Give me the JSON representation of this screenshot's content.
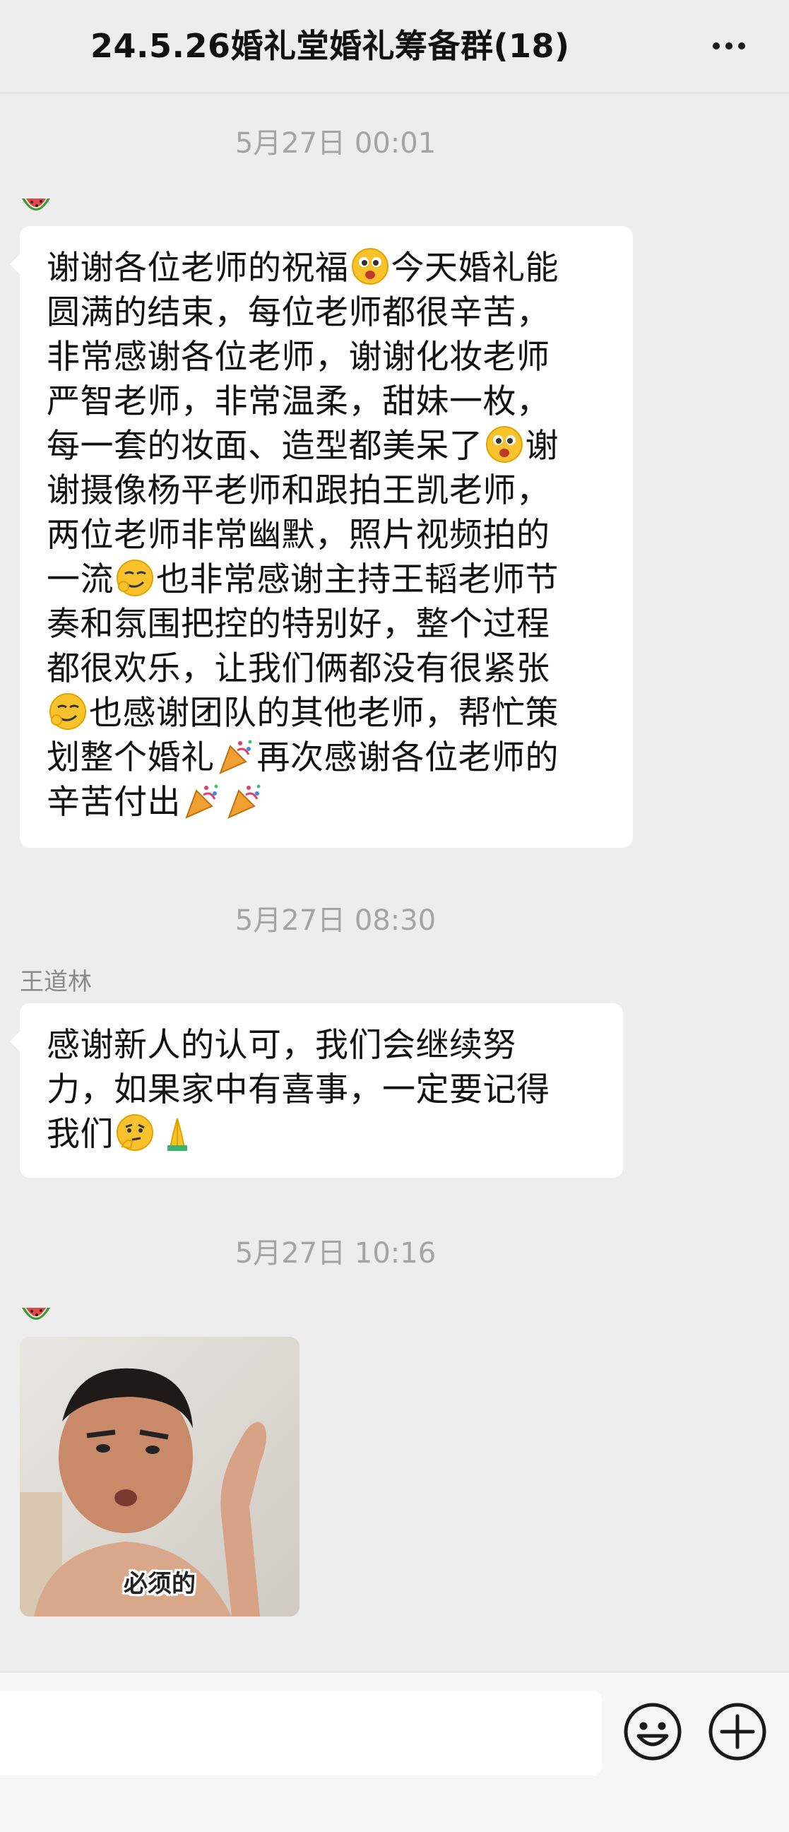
{
  "header": {
    "title": "24.5.26婚礼堂婚礼筹备群(18)",
    "more_icon": "more-dots-icon"
  },
  "messages": [
    {
      "timestamp": "5月27日 00:01",
      "sender_avatar_icon": "watermelon-icon",
      "lines": [
        "谢谢各位老师的祝福",
        "今天婚礼能",
        "圆满的结束，每位老师都很辛苦，",
        "非常感谢各位老师，谢谢化妆老师",
        "严智老师，非常温柔，甜妹一枚，",
        "每一套的妆面、造型都美呆了",
        "谢",
        "谢摄像杨平老师和跟拍王凯老师，",
        "两位老师非常幽默，照片视频拍的",
        "一流",
        "也非常感谢主持王韬老师节",
        "奏和氛围把控的特别好，整个过程",
        "都很欢乐，让我们俩都没有很紧张",
        "也感谢团队的其他老师，帮忙策",
        "划整个婚礼",
        "再次感谢各位老师的",
        "辛苦付出"
      ]
    },
    {
      "timestamp": "5月27日 08:30",
      "sender": "王道林",
      "lines": [
        "感谢新人的认可，我们会继续努",
        "力，如果家中有喜事，一定要记得",
        "我们"
      ]
    },
    {
      "timestamp": "5月27日 10:16",
      "sender_avatar_icon": "watermelon-icon",
      "sticker_caption": "必须的"
    }
  ],
  "input": {
    "placeholder": "",
    "emoji_icon": "emoji-smile-icon",
    "plus_icon": "plus-circle-icon"
  }
}
